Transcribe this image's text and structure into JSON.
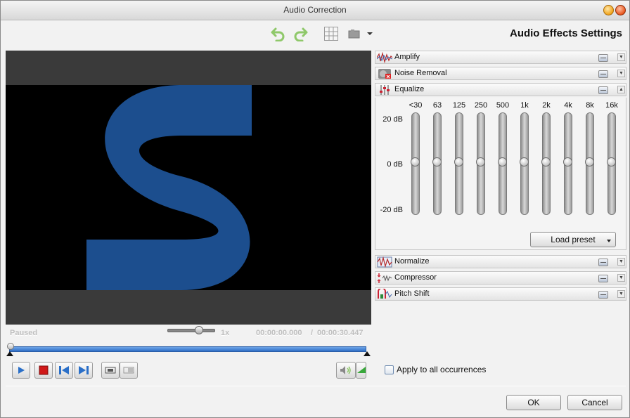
{
  "window": {
    "title": "Audio Correction"
  },
  "toolbar": {
    "undo_icon": "undo-arrow-icon",
    "redo_icon": "redo-arrow-icon",
    "grid_icon": "grid-icon",
    "snapshot_icon": "camera-icon",
    "dropdown_icon": "chevron-down-icon"
  },
  "heading": "Audio Effects Settings",
  "player": {
    "status": "Paused",
    "speed": "1x",
    "current_time": "00:00:00.000",
    "time_separator": "/",
    "total_time": "00:00:30.447",
    "progress_fraction": 0.0,
    "speed_fraction": 0.7
  },
  "effects": {
    "amplify": {
      "label": "Amplify",
      "icon": "waveform-icon"
    },
    "noise_removal": {
      "label": "Noise Removal",
      "icon": "noise-icon"
    },
    "equalize": {
      "label": "Equalize",
      "icon": "equalizer-icon"
    },
    "normalize": {
      "label": "Normalize",
      "icon": "normalize-icon"
    },
    "compressor": {
      "label": "Compressor",
      "icon": "compressor-icon"
    },
    "pitch_shift": {
      "label": "Pitch Shift",
      "icon": "pitch-icon"
    }
  },
  "equalizer": {
    "bands": [
      {
        "label": "<30",
        "gain_db": 0
      },
      {
        "label": "63",
        "gain_db": 0
      },
      {
        "label": "125",
        "gain_db": 0
      },
      {
        "label": "250",
        "gain_db": 0
      },
      {
        "label": "500",
        "gain_db": 0
      },
      {
        "label": "1k",
        "gain_db": 0
      },
      {
        "label": "2k",
        "gain_db": 0
      },
      {
        "label": "4k",
        "gain_db": 0
      },
      {
        "label": "8k",
        "gain_db": 0
      },
      {
        "label": "16k",
        "gain_db": 0
      }
    ],
    "db_max": "20 dB",
    "db_mid": "0 dB",
    "db_min": "-20 dB",
    "load_preset": "Load preset"
  },
  "apply_all": "Apply to all occurrences",
  "buttons": {
    "ok": "OK",
    "cancel": "Cancel"
  },
  "colors": {
    "accent": "#2f6fc6",
    "logo_blue": "#1c4e8e"
  }
}
